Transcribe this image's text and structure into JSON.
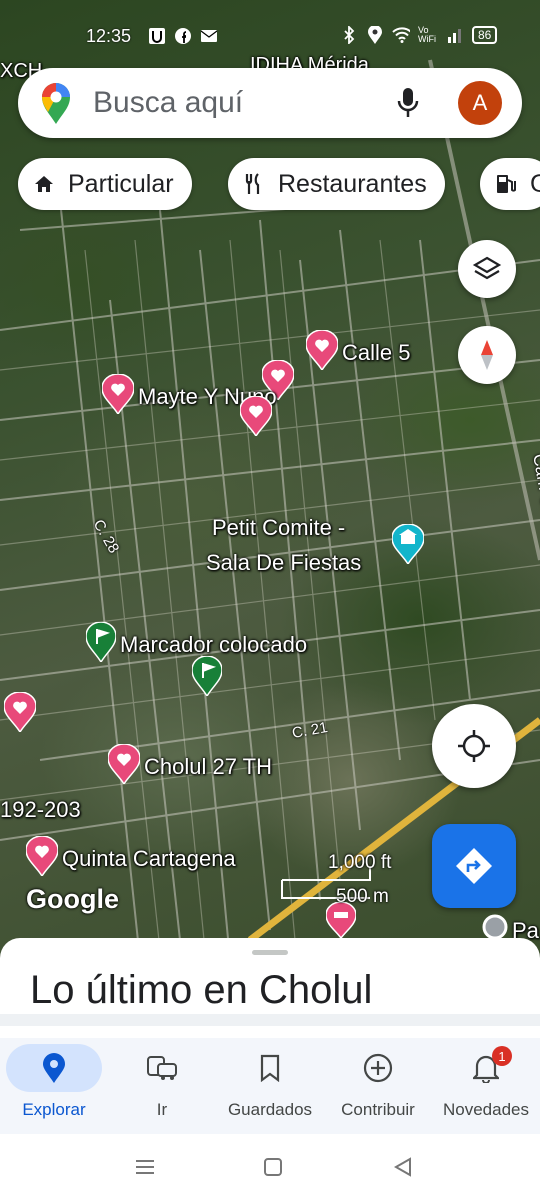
{
  "status_bar": {
    "time": "12:35",
    "wifi_label": "Vo WiFi",
    "battery": "86"
  },
  "map": {
    "top_labels": [
      "XCH",
      "IDIHA Mérida"
    ],
    "places": {
      "calle5": "Calle 5",
      "mayte": "Mayte Y Nuno",
      "petit_line1": "Petit Comite -",
      "petit_line2": "Sala De Fiestas",
      "marcador": "Marcador colocado",
      "cholul27": "Cholul 27 TH",
      "quinta": "Quinta Cartagena",
      "range": "192-203",
      "pa": "Pa"
    },
    "streets": {
      "c28": "C. 28",
      "c21": "C. 21",
      "carr": "Carr. Cho"
    },
    "scale_top": "1,000 ft",
    "scale_bottom": "500 m",
    "attribution": "Google"
  },
  "search": {
    "placeholder": "Busca aquí",
    "avatar_letter": "A"
  },
  "chips": [
    {
      "label": "Particular",
      "icon": "home-icon"
    },
    {
      "label": "Restaurantes",
      "icon": "restaurant-icon"
    },
    {
      "label": "G",
      "icon": "gas-station-icon"
    }
  ],
  "sheet": {
    "title": "Lo último en Cholul"
  },
  "nav": {
    "items": [
      {
        "label": "Explorar",
        "icon": "location-pin-icon"
      },
      {
        "label": "Ir",
        "icon": "commute-icon"
      },
      {
        "label": "Guardados",
        "icon": "bookmark-icon"
      },
      {
        "label": "Contribuir",
        "icon": "add-circle-icon"
      },
      {
        "label": "Novedades",
        "icon": "bell-icon"
      }
    ],
    "badge": "1"
  },
  "colors": {
    "accent": "#1a73e8",
    "active_nav": "#0b57d0",
    "pin_pink": "#e8497a",
    "pin_green": "#188038",
    "pin_teal": "#12b5cb",
    "avatar": "#c2410c"
  }
}
